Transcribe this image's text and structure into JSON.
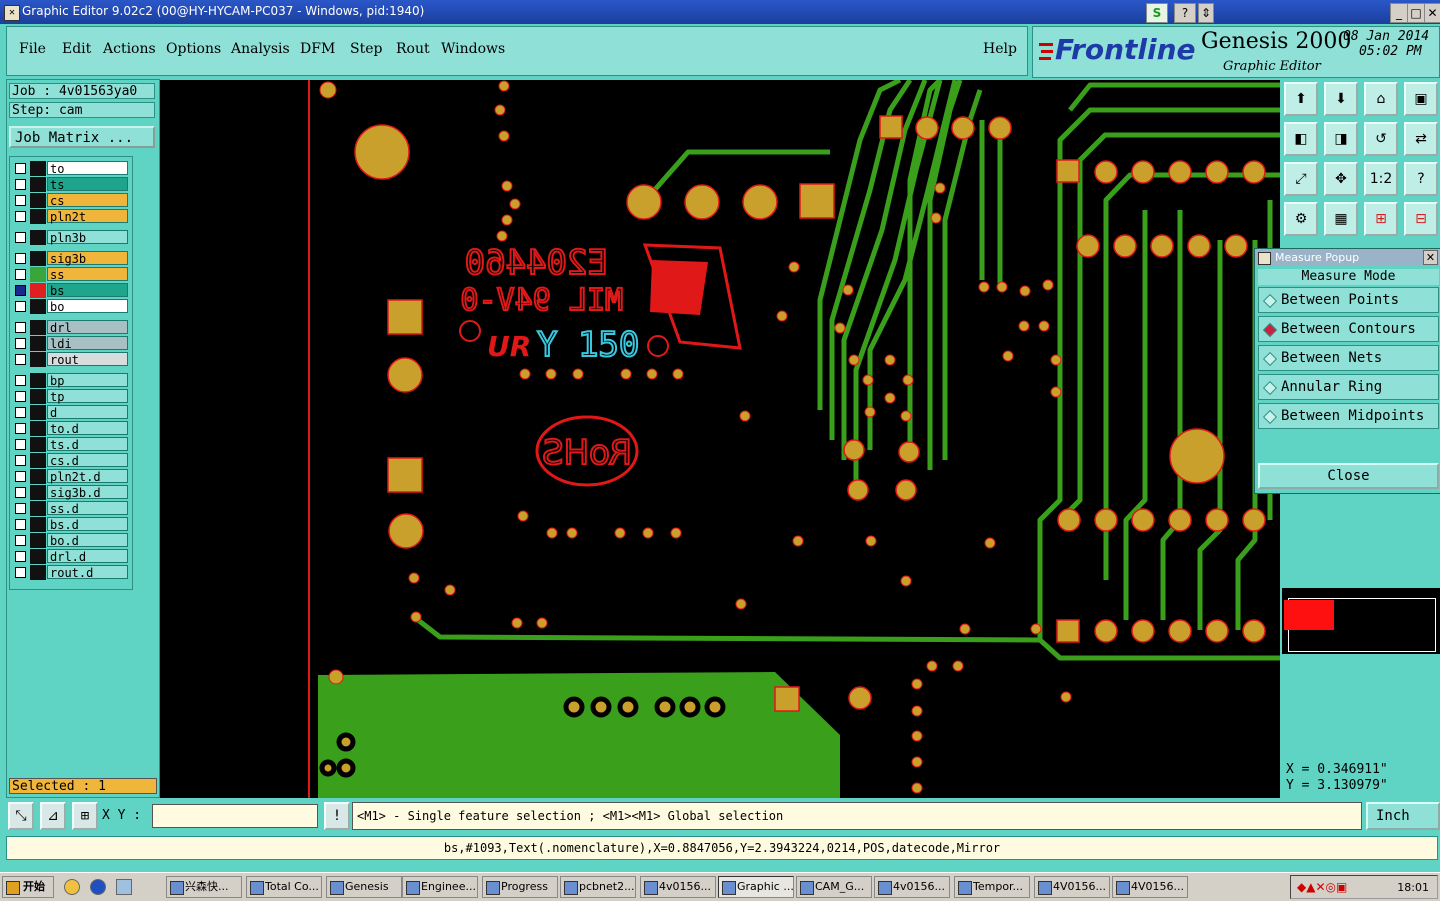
{
  "window": {
    "title": "Graphic Editor 9.02c2 (00@HY-HYCAM-PC037 - Windows, pid:1940)",
    "controls": [
      "_",
      "□",
      "✕"
    ],
    "extra_buttons": [
      "S",
      "?",
      "⇕"
    ]
  },
  "menu": {
    "items": [
      "File",
      "Edit",
      "Actions",
      "Options",
      "Analysis",
      "DFM",
      "Step",
      "Rout",
      "Windows"
    ],
    "help": "Help"
  },
  "brand": {
    "logo": "Frontline",
    "product": "Genesis 2000",
    "module": "Graphic Editor",
    "date": "08 Jan 2014",
    "time": "05:02 PM"
  },
  "job": {
    "job_label": "Job : 4v01563ya0",
    "step_label": "Step: cam",
    "matrix_button": "Job Matrix ...",
    "selected_label": "Selected : 1"
  },
  "layers": [
    {
      "name": "to",
      "bg": "#ffffff",
      "swatch": "#111111"
    },
    {
      "name": "ts",
      "bg": "#1fa58c",
      "swatch": "#111111"
    },
    {
      "name": "cs",
      "bg": "#f0b63c",
      "swatch": "#111111"
    },
    {
      "name": "pln2t",
      "bg": "#f0b63c",
      "swatch": "#111111"
    },
    {
      "name": "pln3b",
      "bg": "#8fe0d6",
      "swatch": "#111111"
    },
    {
      "name": "sig3b",
      "bg": "#f0b63c",
      "swatch": "#111111"
    },
    {
      "name": "ss",
      "bg": "#f0b63c",
      "swatch": "#3aa53a"
    },
    {
      "name": "bs",
      "bg": "#1fa58c",
      "swatch": "#e02020"
    },
    {
      "name": "bo",
      "bg": "#ffffff",
      "swatch": "#111111"
    },
    {
      "name": "drl",
      "bg": "#a8c0c4",
      "swatch": "#111111"
    },
    {
      "name": "ldi",
      "bg": "#a8c0c4",
      "swatch": "#111111"
    },
    {
      "name": "rout",
      "bg": "#d8dcdc",
      "swatch": "#111111"
    },
    {
      "name": "bp",
      "bg": "#8fe0d6",
      "swatch": "#111111"
    },
    {
      "name": "tp",
      "bg": "#8fe0d6",
      "swatch": "#111111"
    },
    {
      "name": "d",
      "bg": "#8fe0d6",
      "swatch": "#111111"
    },
    {
      "name": "to.d",
      "bg": "#8fe0d6",
      "swatch": "#111111"
    },
    {
      "name": "ts.d",
      "bg": "#8fe0d6",
      "swatch": "#111111"
    },
    {
      "name": "cs.d",
      "bg": "#8fe0d6",
      "swatch": "#111111"
    },
    {
      "name": "pln2t.d",
      "bg": "#8fe0d6",
      "swatch": "#111111"
    },
    {
      "name": "sig3b.d",
      "bg": "#8fe0d6",
      "swatch": "#111111"
    },
    {
      "name": "ss.d",
      "bg": "#8fe0d6",
      "swatch": "#111111"
    },
    {
      "name": "bs.d",
      "bg": "#8fe0d6",
      "swatch": "#111111"
    },
    {
      "name": "bo.d",
      "bg": "#8fe0d6",
      "swatch": "#111111"
    },
    {
      "name": "drl.d",
      "bg": "#8fe0d6",
      "swatch": "#111111"
    },
    {
      "name": "rout.d",
      "bg": "#8fe0d6",
      "swatch": "#111111"
    }
  ],
  "canvas_text": {
    "code": "E204460",
    "rating": "MIL 94V-0",
    "ur": "UR",
    "datecode": "Y 150",
    "rohs": "RoHS"
  },
  "measure_popup": {
    "title": "Measure Popup",
    "mode_header": "Measure Mode",
    "modes": [
      "Between Points",
      "Between Contours",
      "Between Nets",
      "Annular Ring",
      "Between Midpoints"
    ],
    "active_mode": "Between Contours",
    "close": "Close"
  },
  "tools": {
    "labels": [
      "1:2",
      "?"
    ]
  },
  "coords": {
    "x": "X = 0.346911\"",
    "y": "Y = 3.130979\""
  },
  "bottom": {
    "xy_label": "X Y :",
    "xy_value": "",
    "message": "<M1> - Single feature selection ; <M1><M1> Global selection",
    "unit": "Inch",
    "status": "bs,#1093,Text(.nomenclature),X=0.8847056,Y=2.3943224,0214,POS,datecode,Mirror"
  },
  "taskbar": {
    "start": "开始",
    "tasks": [
      "兴森快...",
      "Total Co...",
      "Genesis",
      "Enginee...",
      "Progress",
      "pcbnet2...",
      "4v0156...",
      "Graphic ...",
      "CAM_G...",
      "4v0156...",
      "Tempor...",
      "4V0156...",
      "4V0156..."
    ],
    "active_task": "Graphic ...",
    "clock": "18:01"
  },
  "colors": {
    "pad": "#c9a02c",
    "pad_outline": "#e01818",
    "trace": "#3aa01c",
    "silk": "#e01818",
    "datecode": "#38c8e0"
  }
}
